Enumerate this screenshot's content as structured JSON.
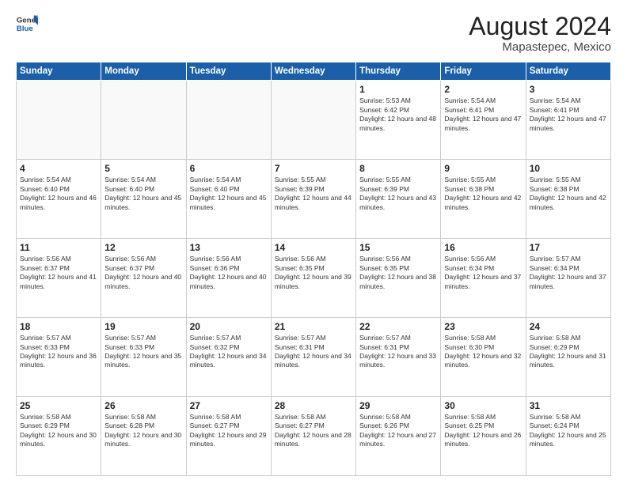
{
  "header": {
    "logo_general": "General",
    "logo_blue": "Blue",
    "month_year": "August 2024",
    "location": "Mapastepec, Mexico"
  },
  "days_of_week": [
    "Sunday",
    "Monday",
    "Tuesday",
    "Wednesday",
    "Thursday",
    "Friday",
    "Saturday"
  ],
  "weeks": [
    [
      {
        "day": "",
        "sunrise": "",
        "sunset": "",
        "daylight": ""
      },
      {
        "day": "",
        "sunrise": "",
        "sunset": "",
        "daylight": ""
      },
      {
        "day": "",
        "sunrise": "",
        "sunset": "",
        "daylight": ""
      },
      {
        "day": "",
        "sunrise": "",
        "sunset": "",
        "daylight": ""
      },
      {
        "day": "1",
        "sunrise": "Sunrise: 5:53 AM",
        "sunset": "Sunset: 6:42 PM",
        "daylight": "Daylight: 12 hours and 48 minutes."
      },
      {
        "day": "2",
        "sunrise": "Sunrise: 5:54 AM",
        "sunset": "Sunset: 6:41 PM",
        "daylight": "Daylight: 12 hours and 47 minutes."
      },
      {
        "day": "3",
        "sunrise": "Sunrise: 5:54 AM",
        "sunset": "Sunset: 6:41 PM",
        "daylight": "Daylight: 12 hours and 47 minutes."
      }
    ],
    [
      {
        "day": "4",
        "sunrise": "Sunrise: 5:54 AM",
        "sunset": "Sunset: 6:40 PM",
        "daylight": "Daylight: 12 hours and 46 minutes."
      },
      {
        "day": "5",
        "sunrise": "Sunrise: 5:54 AM",
        "sunset": "Sunset: 6:40 PM",
        "daylight": "Daylight: 12 hours and 45 minutes."
      },
      {
        "day": "6",
        "sunrise": "Sunrise: 5:54 AM",
        "sunset": "Sunset: 6:40 PM",
        "daylight": "Daylight: 12 hours and 45 minutes."
      },
      {
        "day": "7",
        "sunrise": "Sunrise: 5:55 AM",
        "sunset": "Sunset: 6:39 PM",
        "daylight": "Daylight: 12 hours and 44 minutes."
      },
      {
        "day": "8",
        "sunrise": "Sunrise: 5:55 AM",
        "sunset": "Sunset: 6:39 PM",
        "daylight": "Daylight: 12 hours and 43 minutes."
      },
      {
        "day": "9",
        "sunrise": "Sunrise: 5:55 AM",
        "sunset": "Sunset: 6:38 PM",
        "daylight": "Daylight: 12 hours and 42 minutes."
      },
      {
        "day": "10",
        "sunrise": "Sunrise: 5:55 AM",
        "sunset": "Sunset: 6:38 PM",
        "daylight": "Daylight: 12 hours and 42 minutes."
      }
    ],
    [
      {
        "day": "11",
        "sunrise": "Sunrise: 5:56 AM",
        "sunset": "Sunset: 6:37 PM",
        "daylight": "Daylight: 12 hours and 41 minutes."
      },
      {
        "day": "12",
        "sunrise": "Sunrise: 5:56 AM",
        "sunset": "Sunset: 6:37 PM",
        "daylight": "Daylight: 12 hours and 40 minutes."
      },
      {
        "day": "13",
        "sunrise": "Sunrise: 5:56 AM",
        "sunset": "Sunset: 6:36 PM",
        "daylight": "Daylight: 12 hours and 40 minutes."
      },
      {
        "day": "14",
        "sunrise": "Sunrise: 5:56 AM",
        "sunset": "Sunset: 6:35 PM",
        "daylight": "Daylight: 12 hours and 39 minutes."
      },
      {
        "day": "15",
        "sunrise": "Sunrise: 5:56 AM",
        "sunset": "Sunset: 6:35 PM",
        "daylight": "Daylight: 12 hours and 38 minutes."
      },
      {
        "day": "16",
        "sunrise": "Sunrise: 5:56 AM",
        "sunset": "Sunset: 6:34 PM",
        "daylight": "Daylight: 12 hours and 37 minutes."
      },
      {
        "day": "17",
        "sunrise": "Sunrise: 5:57 AM",
        "sunset": "Sunset: 6:34 PM",
        "daylight": "Daylight: 12 hours and 37 minutes."
      }
    ],
    [
      {
        "day": "18",
        "sunrise": "Sunrise: 5:57 AM",
        "sunset": "Sunset: 6:33 PM",
        "daylight": "Daylight: 12 hours and 36 minutes."
      },
      {
        "day": "19",
        "sunrise": "Sunrise: 5:57 AM",
        "sunset": "Sunset: 6:33 PM",
        "daylight": "Daylight: 12 hours and 35 minutes."
      },
      {
        "day": "20",
        "sunrise": "Sunrise: 5:57 AM",
        "sunset": "Sunset: 6:32 PM",
        "daylight": "Daylight: 12 hours and 34 minutes."
      },
      {
        "day": "21",
        "sunrise": "Sunrise: 5:57 AM",
        "sunset": "Sunset: 6:31 PM",
        "daylight": "Daylight: 12 hours and 34 minutes."
      },
      {
        "day": "22",
        "sunrise": "Sunrise: 5:57 AM",
        "sunset": "Sunset: 6:31 PM",
        "daylight": "Daylight: 12 hours and 33 minutes."
      },
      {
        "day": "23",
        "sunrise": "Sunrise: 5:58 AM",
        "sunset": "Sunset: 6:30 PM",
        "daylight": "Daylight: 12 hours and 32 minutes."
      },
      {
        "day": "24",
        "sunrise": "Sunrise: 5:58 AM",
        "sunset": "Sunset: 6:29 PM",
        "daylight": "Daylight: 12 hours and 31 minutes."
      }
    ],
    [
      {
        "day": "25",
        "sunrise": "Sunrise: 5:58 AM",
        "sunset": "Sunset: 6:29 PM",
        "daylight": "Daylight: 12 hours and 30 minutes."
      },
      {
        "day": "26",
        "sunrise": "Sunrise: 5:58 AM",
        "sunset": "Sunset: 6:28 PM",
        "daylight": "Daylight: 12 hours and 30 minutes."
      },
      {
        "day": "27",
        "sunrise": "Sunrise: 5:58 AM",
        "sunset": "Sunset: 6:27 PM",
        "daylight": "Daylight: 12 hours and 29 minutes."
      },
      {
        "day": "28",
        "sunrise": "Sunrise: 5:58 AM",
        "sunset": "Sunset: 6:27 PM",
        "daylight": "Daylight: 12 hours and 28 minutes."
      },
      {
        "day": "29",
        "sunrise": "Sunrise: 5:58 AM",
        "sunset": "Sunset: 6:26 PM",
        "daylight": "Daylight: 12 hours and 27 minutes."
      },
      {
        "day": "30",
        "sunrise": "Sunrise: 5:58 AM",
        "sunset": "Sunset: 6:25 PM",
        "daylight": "Daylight: 12 hours and 26 minutes."
      },
      {
        "day": "31",
        "sunrise": "Sunrise: 5:58 AM",
        "sunset": "Sunset: 6:24 PM",
        "daylight": "Daylight: 12 hours and 25 minutes."
      }
    ]
  ]
}
